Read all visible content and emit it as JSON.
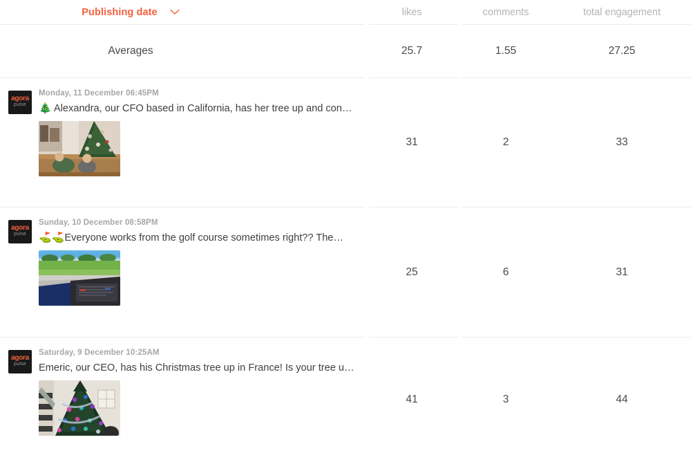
{
  "header": {
    "sort_column_label": "Publishing date",
    "sort_icon": "chevron-down-icon",
    "columns": [
      "likes",
      "comments",
      "total engagement"
    ],
    "accent_color": "#f4603e"
  },
  "averages_row": {
    "label": "Averages",
    "likes": "25.7",
    "comments": "1.55",
    "total_engagement": "27.25"
  },
  "posts": [
    {
      "avatar_name": "agorapulse-logo",
      "avatar_top_text": "agora",
      "avatar_bottom_text": "pulse",
      "date": "Monday, 11 December 06:45PM",
      "emoji": "🎄",
      "text": " Alexandra, our CFO based in California, has her tree up and con…",
      "thumbnail_name": "post-thumbnail-children-christmas-tree",
      "likes": "31",
      "comments": "2",
      "total_engagement": "33"
    },
    {
      "avatar_name": "agorapulse-logo",
      "avatar_top_text": "agora",
      "avatar_bottom_text": "pulse",
      "date": "Sunday, 10 December 08:58PM",
      "emoji": "⛳⛳",
      "text": "Everyone works from the golf course sometimes right?? The…",
      "thumbnail_name": "post-thumbnail-golf-course-laptop",
      "likes": "25",
      "comments": "6",
      "total_engagement": "31"
    },
    {
      "avatar_name": "agorapulse-logo",
      "avatar_top_text": "agora",
      "avatar_bottom_text": "pulse",
      "date": "Saturday, 9 December 10:25AM",
      "emoji": "",
      "text": "Emeric, our CEO, has his Christmas tree up in France! Is your tree u…",
      "thumbnail_name": "post-thumbnail-decorated-christmas-tree",
      "likes": "41",
      "comments": "3",
      "total_engagement": "44"
    }
  ]
}
